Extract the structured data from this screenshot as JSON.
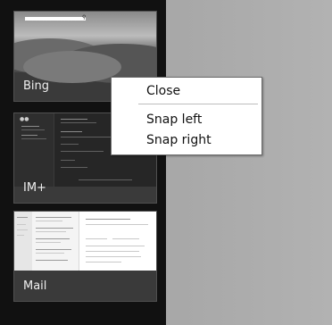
{
  "apps": [
    {
      "label": "Bing"
    },
    {
      "label": "IM+"
    },
    {
      "label": "Mail"
    }
  ],
  "context_menu": {
    "close": "Close",
    "snap_left": "Snap left",
    "snap_right": "Snap right"
  }
}
